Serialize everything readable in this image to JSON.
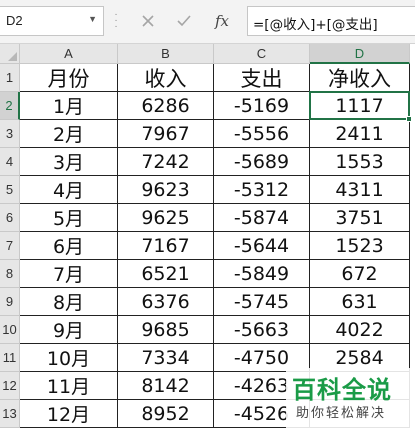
{
  "formula_bar": {
    "name_box": "D2",
    "cancel_icon": "close-icon",
    "enter_icon": "check-icon",
    "function_icon": "fx-icon",
    "function_label": "fx",
    "formula": "=[@收入]+[@支出]"
  },
  "columns": [
    "A",
    "B",
    "C",
    "D"
  ],
  "rows": [
    "1",
    "2",
    "3",
    "4",
    "5",
    "6",
    "7",
    "8",
    "9",
    "10",
    "11",
    "12",
    "13"
  ],
  "headers": [
    "月份",
    "收入",
    "支出",
    "净收入"
  ],
  "data": [
    [
      "1月",
      "6286",
      "-5169",
      "1117"
    ],
    [
      "2月",
      "7967",
      "-5556",
      "2411"
    ],
    [
      "3月",
      "7242",
      "-5689",
      "1553"
    ],
    [
      "4月",
      "9623",
      "-5312",
      "4311"
    ],
    [
      "5月",
      "9625",
      "-5874",
      "3751"
    ],
    [
      "6月",
      "7167",
      "-5644",
      "1523"
    ],
    [
      "7月",
      "6521",
      "-5849",
      "672"
    ],
    [
      "8月",
      "6376",
      "-5745",
      "631"
    ],
    [
      "9月",
      "9685",
      "-5663",
      "4022"
    ],
    [
      "10月",
      "7334",
      "-4750",
      "2584"
    ],
    [
      "11月",
      "8142",
      "-4263",
      ""
    ],
    [
      "12月",
      "8952",
      "-4526",
      ""
    ]
  ],
  "selected": {
    "column": "D",
    "row": "2"
  },
  "watermark": {
    "title": "百科全说",
    "subtitle": "助你轻松解决"
  },
  "colors": {
    "accent": "#217346",
    "watermark": "#1a9b47"
  }
}
